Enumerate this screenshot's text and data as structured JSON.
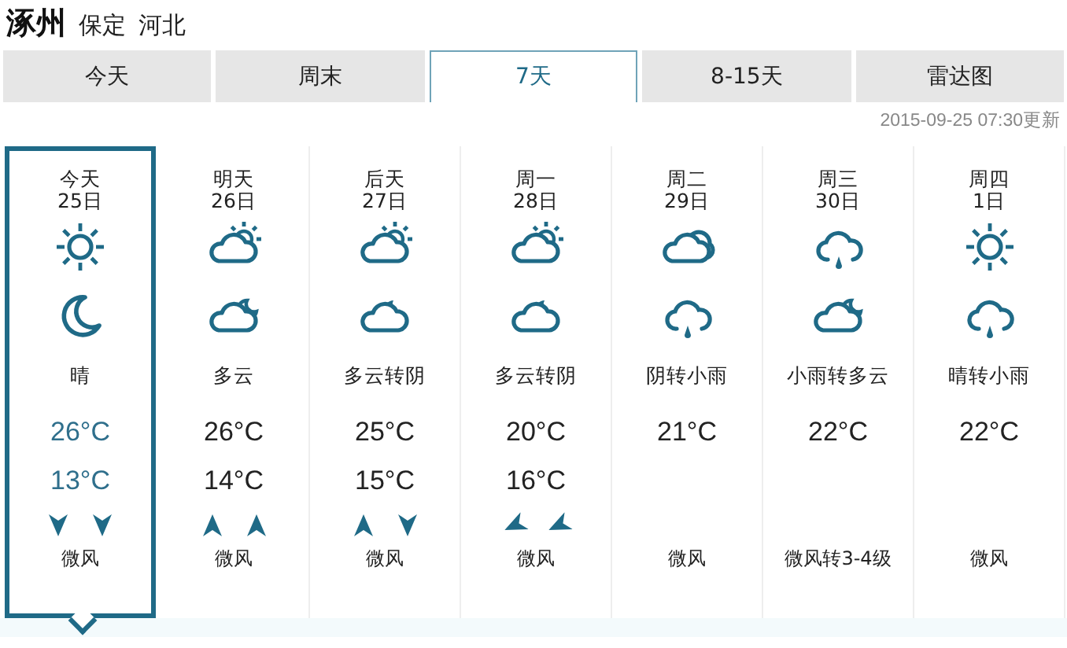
{
  "location": {
    "city": "涿州",
    "region": [
      "保定",
      "河北"
    ]
  },
  "tabs": [
    {
      "label": "今天",
      "selected": false
    },
    {
      "label": "周末",
      "selected": false
    },
    {
      "label": "7天",
      "selected": true
    },
    {
      "label": "8-15天",
      "selected": false
    },
    {
      "label": "雷达图",
      "selected": false
    }
  ],
  "updated": "2015-09-25 07:30更新",
  "days": [
    {
      "day": "今天",
      "date": "25日",
      "icons": [
        {
          "kind": "sun"
        },
        {
          "kind": "moon"
        }
      ],
      "desc": "晴",
      "high": "26°C",
      "low": "13°C",
      "wind_arrows": [
        {
          "kind": "south"
        },
        {
          "kind": "south"
        }
      ],
      "wind": "微风",
      "selected": true
    },
    {
      "day": "明天",
      "date": "26日",
      "icons": [
        {
          "kind": "cloudsun"
        },
        {
          "kind": "cloudmoon"
        }
      ],
      "desc": "多云",
      "high": "26°C",
      "low": "14°C",
      "wind_arrows": [
        {
          "kind": "north"
        },
        {
          "kind": "north"
        }
      ],
      "wind": "微风",
      "selected": false
    },
    {
      "day": "后天",
      "date": "27日",
      "icons": [
        {
          "kind": "cloudsun"
        },
        {
          "kind": "cloudnight"
        }
      ],
      "desc": "多云转阴",
      "high": "25°C",
      "low": "15°C",
      "wind_arrows": [
        {
          "kind": "north"
        },
        {
          "kind": "south"
        }
      ],
      "wind": "微风",
      "selected": false
    },
    {
      "day": "周一",
      "date": "28日",
      "icons": [
        {
          "kind": "cloudsun"
        },
        {
          "kind": "cloudnight"
        }
      ],
      "desc": "多云转阴",
      "high": "20°C",
      "low": "16°C",
      "wind_arrows": [
        {
          "kind": "northeast"
        },
        {
          "kind": "northeast"
        }
      ],
      "wind": "微风",
      "selected": false
    },
    {
      "day": "周二",
      "date": "29日",
      "icons": [
        {
          "kind": "overcast"
        },
        {
          "kind": "rain"
        }
      ],
      "desc": "阴转小雨",
      "high": "21°C",
      "wind": "微风",
      "selected": false
    },
    {
      "day": "周三",
      "date": "30日",
      "icons": [
        {
          "kind": "rain"
        },
        {
          "kind": "cloudmoon"
        }
      ],
      "desc": "小雨转多云",
      "high": "22°C",
      "wind": "微风转3-4级",
      "selected": false
    },
    {
      "day": "周四",
      "date": "1日",
      "icons": [
        {
          "kind": "sun"
        },
        {
          "kind": "rain"
        }
      ],
      "desc": "晴转小雨",
      "high": "22°C",
      "wind": "微风",
      "selected": false
    }
  ]
}
